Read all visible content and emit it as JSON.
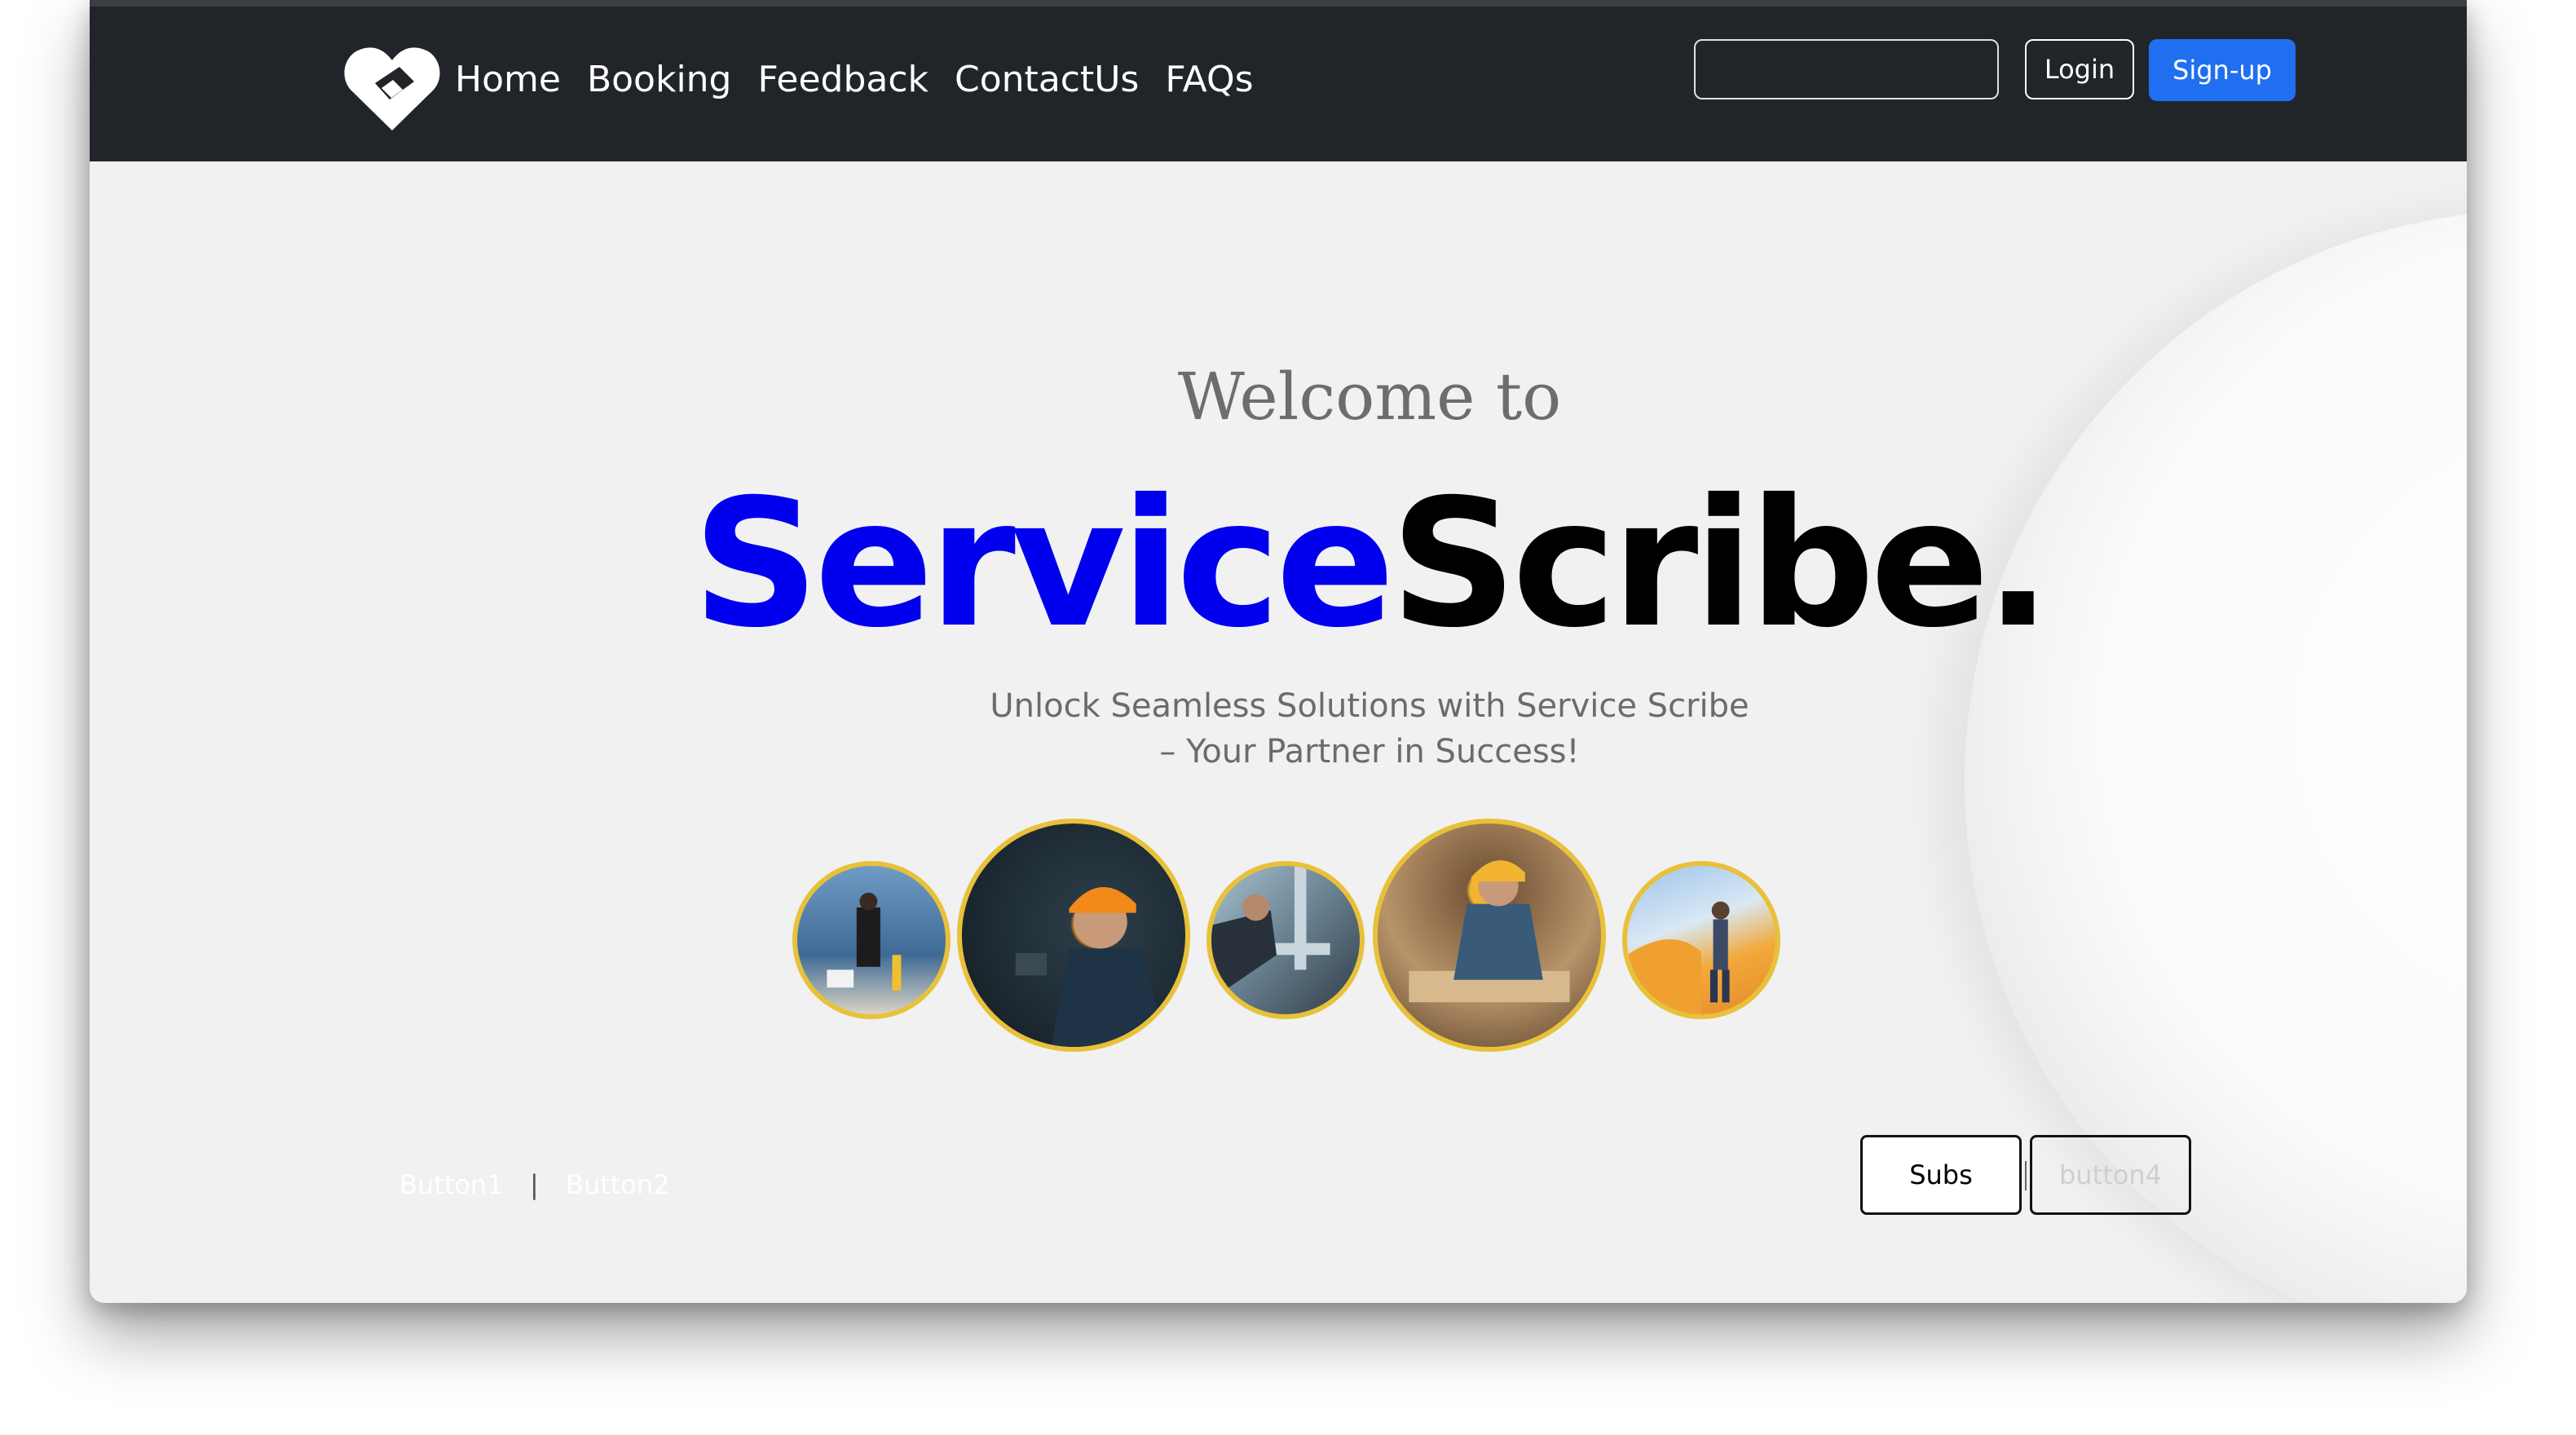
{
  "nav": {
    "links": [
      "Home",
      "Booking",
      "Feedback",
      "ContactUs",
      "FAQs"
    ],
    "search_value": "",
    "login_label": "Login",
    "signup_label": "Sign-up"
  },
  "hero": {
    "welcome": "Welcome to",
    "brand_part1": "Service",
    "brand_part2": "Scribe.",
    "subtitle_line1": "Unlock Seamless Solutions with Service Scribe",
    "subtitle_line2": "– Your Partner in Success!"
  },
  "footer": {
    "button1": "Button1",
    "separator": "|",
    "button2": "Button2",
    "subs": "Subs",
    "button4": "button4"
  },
  "images": [
    "bathroom-cleaner",
    "electrician",
    "plumber",
    "carpenter",
    "painter"
  ],
  "colors": {
    "navbar": "#212529",
    "brand_blue": "#0000ee",
    "signup_blue": "#1f6ff0",
    "circle_border": "#e8c13a"
  }
}
